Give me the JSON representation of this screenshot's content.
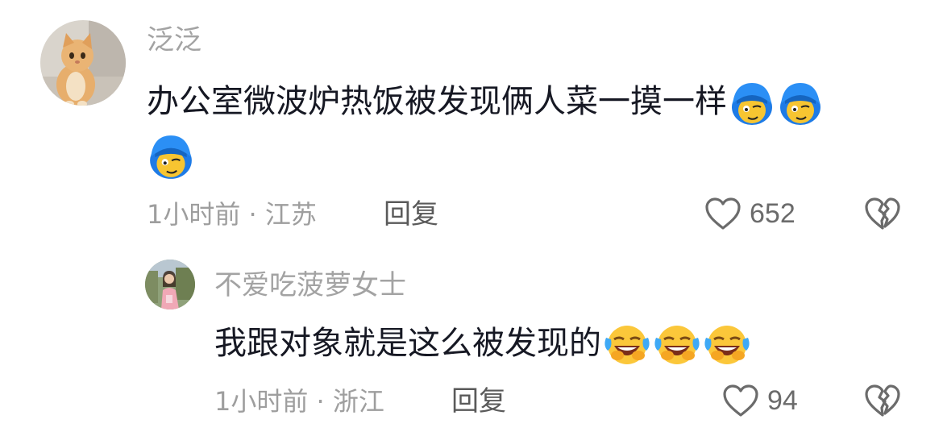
{
  "comments": [
    {
      "username": "泛泛",
      "text": "办公室微波炉热饭被发现俩人菜一摸一样",
      "emojis": [
        "blue-hair-smirk-icon",
        "blue-hair-smirk-icon",
        "blue-hair-smirk-icon"
      ],
      "time": "1小时前",
      "separator": "·",
      "location": "江苏",
      "reply_label": "回复",
      "like_count": "652",
      "avatar_icon": "cat-avatar-icon"
    },
    {
      "username": "不爱吃菠萝女士",
      "text": "我跟对象就是这么被发现的",
      "emojis": [
        "laugh-cry-icon",
        "laugh-cry-icon",
        "laugh-cry-icon"
      ],
      "time": "1小时前",
      "separator": "·",
      "location": "浙江",
      "reply_label": "回复",
      "like_count": "94",
      "avatar_icon": "girl-photo-avatar-icon"
    }
  ],
  "colors": {
    "username": "#a3a3a3",
    "text": "#161823",
    "meta": "#9e9e9e",
    "icon": "#6b6b6b"
  }
}
